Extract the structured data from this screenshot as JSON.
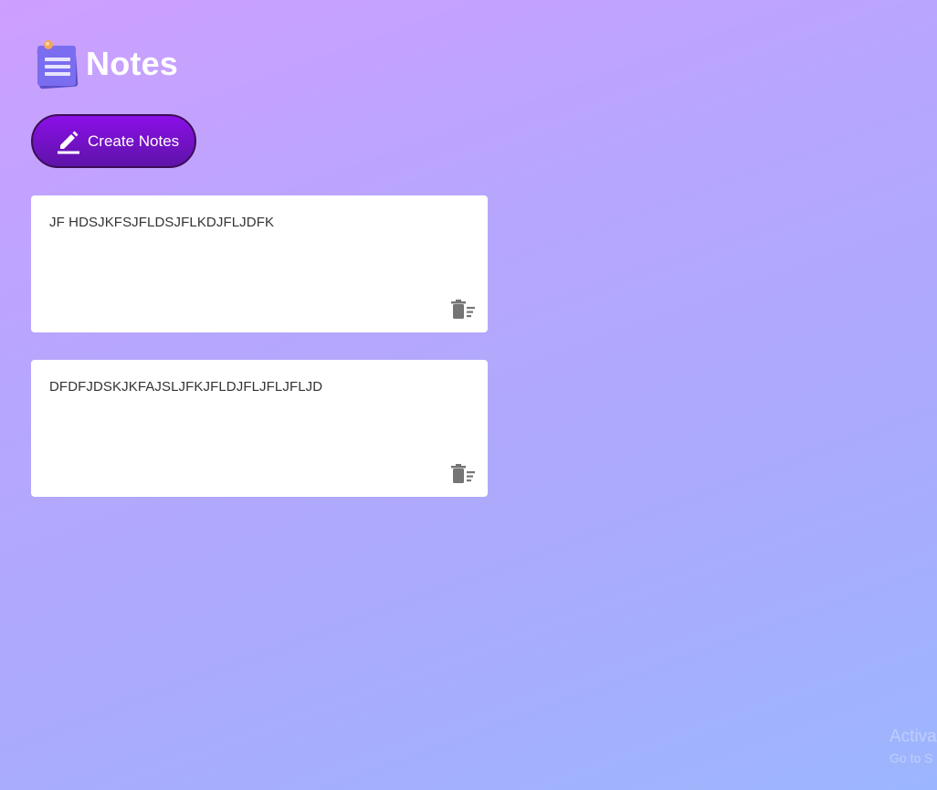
{
  "app": {
    "title": "Notes",
    "logo_icon": "sticky-notes-icon"
  },
  "toolbar": {
    "create_label": "Create Notes",
    "create_icon": "pencil-icon"
  },
  "notes": [
    {
      "text": "JF HDSJKFSJFLDSJFLKDJFLJDFK",
      "delete_icon": "delete-sweep-icon"
    },
    {
      "text": "DFDFJDSKJKFAJSLJFKJFLDJFLJFLJFLJD",
      "delete_icon": "delete-sweep-icon"
    }
  ],
  "watermark": {
    "line1": "Activa",
    "line2": "Go to S"
  },
  "colors": {
    "accent": "#7a10d6",
    "background_start": "#cd9ffe",
    "background_end": "#9cb6fd",
    "card": "#ffffff",
    "note_text": "#333333",
    "icon_gray": "#757575"
  }
}
